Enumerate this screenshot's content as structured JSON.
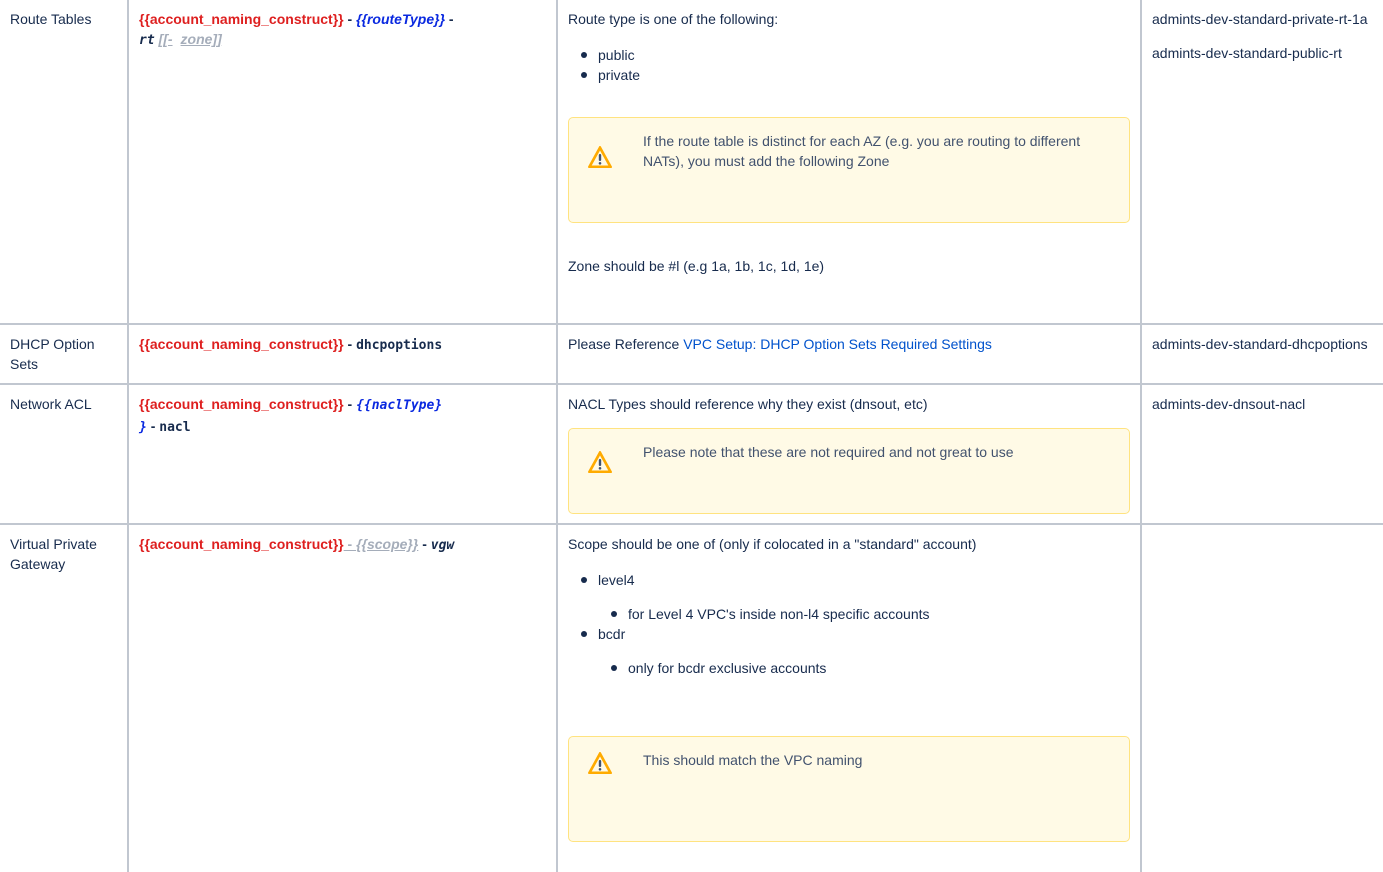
{
  "rows": [
    {
      "name": "Route Tables",
      "pattern": {
        "construct": "{{account_naming_construct}}",
        "sep1": " - ",
        "type": "{{routeType}}",
        "sep2": " -",
        "suffix": "rt",
        "zone_open": "[[-",
        "zone": "zone]]"
      },
      "desc": {
        "intro": "Route type is one of the following:",
        "items": [
          "public",
          "private"
        ],
        "note": "If the route table is distinct for each AZ (e.g. you are routing to different NATs), you must add the following Zone",
        "footer": "Zone should be #l (e.g 1a, 1b, 1c, 1d, 1e)"
      },
      "examples": [
        "admints-dev-standard-private-rt-1a",
        "admints-dev-standard-public-rt"
      ]
    },
    {
      "name": "DHCP Option Sets",
      "pattern": {
        "construct": "{{account_naming_construct}}",
        "sep1": " - ",
        "suffix": "dhcpoptions"
      },
      "desc": {
        "prefix": "Please Reference ",
        "link": "VPC Setup: DHCP Option Sets Required Settings"
      },
      "examples": [
        "admints-dev-standard-dhcpoptions"
      ]
    },
    {
      "name": "Network ACL",
      "pattern": {
        "construct": "{{account_naming_construct}}",
        "sep1": " - ",
        "type_a": "{{naclType}",
        "type_b": "}",
        "sep2": " - ",
        "suffix": "nacl"
      },
      "desc": {
        "intro": "NACL Types should reference why they exist (dnsout, etc)",
        "note": "Please note that these are not required and not great to use"
      },
      "examples": [
        "admints-dev-dnsout-nacl"
      ]
    },
    {
      "name": "Virtual Private Gateway",
      "pattern": {
        "construct": "{{account_naming_construct}}",
        "sep1": " - ",
        "scope": "{{scope}}",
        "sep2": " - ",
        "suffix": "vgw"
      },
      "desc": {
        "intro": "Scope should be one of (only if colocated in a \"standard\" account)",
        "items": [
          {
            "label": "level4",
            "sub": "for Level 4 VPC's inside non-l4 specific accounts"
          },
          {
            "label": "bcdr",
            "sub": "only for bcdr exclusive accounts"
          }
        ],
        "note": "This should match the VPC naming"
      },
      "examples": []
    }
  ],
  "colors": {
    "placeholder_red": "#de1f1f",
    "placeholder_blue": "#0a29e0",
    "placeholder_gray": "#a5adba",
    "note_bg": "#fffae6",
    "note_border": "#ffe380",
    "link": "#0052cc",
    "table_border": "#c1c7d0"
  },
  "icons": {
    "note": "warning-icon"
  }
}
